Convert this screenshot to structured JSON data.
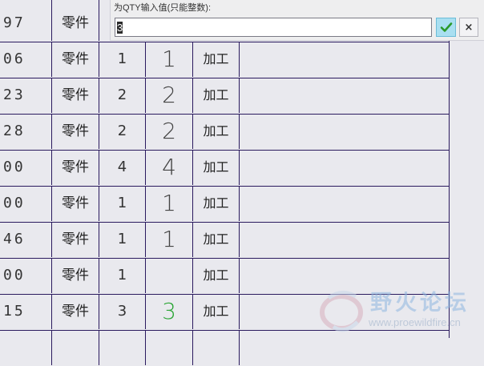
{
  "popup": {
    "label": "为QTY输入值(只能整数):",
    "input_value": "3",
    "ok_icon": "checkmark-icon",
    "cancel_label": "×",
    "colors": {
      "ok_bg": "#a9dff1",
      "ok_check": "#2a9a2a"
    }
  },
  "table": {
    "rows": [
      {
        "num": "97",
        "type": "零件",
        "qty": "",
        "qty2": "",
        "proc": ""
      },
      {
        "num": "06",
        "type": "零件",
        "qty": "1",
        "qty2": "1",
        "proc": "加工"
      },
      {
        "num": "23",
        "type": "零件",
        "qty": "2",
        "qty2": "2",
        "proc": "加工"
      },
      {
        "num": "28",
        "type": "零件",
        "qty": "2",
        "qty2": "2",
        "proc": "加工"
      },
      {
        "num": "00",
        "type": "零件",
        "qty": "4",
        "qty2": "4",
        "proc": "加工"
      },
      {
        "num": "00",
        "type": "零件",
        "qty": "1",
        "qty2": "1",
        "proc": "加工"
      },
      {
        "num": "46",
        "type": "零件",
        "qty": "1",
        "qty2": "1",
        "proc": "加工"
      },
      {
        "num": "00",
        "type": "零件",
        "qty": "1",
        "qty2": "",
        "proc": "加工"
      },
      {
        "num": "15",
        "type": "零件",
        "qty": "3",
        "qty2": "3",
        "proc": "加工"
      },
      {
        "num": "",
        "type": "",
        "qty": "",
        "qty2": "",
        "proc": ""
      }
    ],
    "highlight_color": "#2aa534"
  },
  "watermark": {
    "title": "野火论坛",
    "url": "www.proewildfire.cn"
  }
}
